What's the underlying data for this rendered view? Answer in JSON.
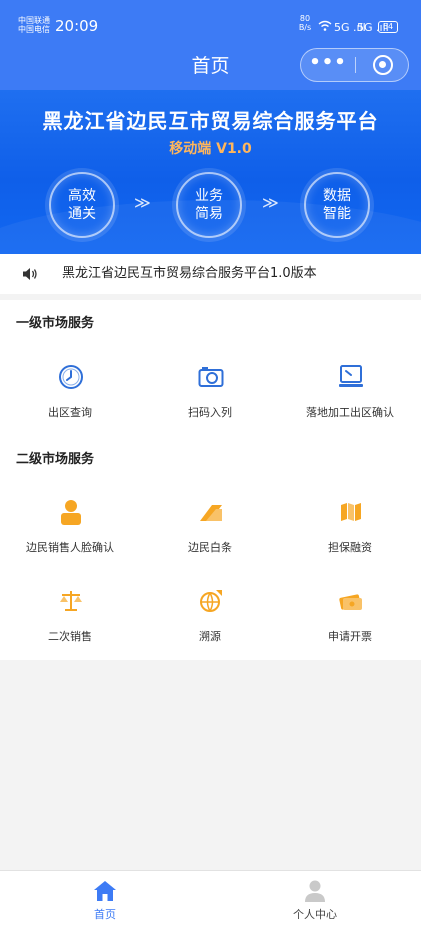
{
  "status_bar": {
    "carrier1": "中国联通",
    "carrier2": "中国电信",
    "time": "20:09",
    "net_speed_value": "80",
    "net_speed_unit": "B/s",
    "signal1": "5G .ıll",
    "signal2": "5G .ıll",
    "battery": "64"
  },
  "header": {
    "title": "首页",
    "more_label": "•••"
  },
  "banner": {
    "title": "黑龙江省边民互市贸易综合服务平台",
    "subtitle": "移动端 V1.0",
    "features": [
      {
        "line1": "高效",
        "line2": "通关"
      },
      {
        "line1": "业务",
        "line2": "简易"
      },
      {
        "line1": "数据",
        "line2": "智能"
      }
    ],
    "arrow": "≫"
  },
  "notice": {
    "text": "黑龙江省边民互市贸易综合服务平台1.0版本"
  },
  "sections": [
    {
      "title": "一级市场服务",
      "items": [
        {
          "label": "出区查询",
          "icon": "clock-icon"
        },
        {
          "label": "扫码入列",
          "icon": "camera-icon"
        },
        {
          "label": "落地加工出区确认",
          "icon": "monitor-icon"
        }
      ]
    },
    {
      "title": "二级市场服务",
      "items": [
        {
          "label": "边民销售人脸确认",
          "icon": "person-icon"
        },
        {
          "label": "边民白条",
          "icon": "card-icon"
        },
        {
          "label": "担保融资",
          "icon": "map-icon"
        },
        {
          "label": "二次销售",
          "icon": "scale-icon"
        },
        {
          "label": "溯源",
          "icon": "globe-icon"
        },
        {
          "label": "申请开票",
          "icon": "ticket-icon"
        }
      ]
    }
  ],
  "tabbar": {
    "tabs": [
      {
        "label": "首页",
        "icon": "home-icon"
      },
      {
        "label": "个人中心",
        "icon": "user-icon"
      }
    ]
  },
  "colors": {
    "primary": "#3d7bf5",
    "banner": "#1266f0",
    "accent_orange": "#f6a623",
    "icon_blue": "#2f6fd8"
  }
}
